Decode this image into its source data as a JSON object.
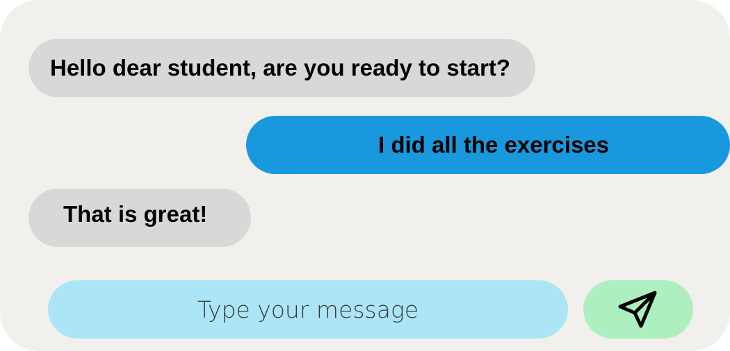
{
  "chat": {
    "messages": [
      {
        "sender": "teacher",
        "text": "Hello dear student, are you ready to start?"
      },
      {
        "sender": "student",
        "text": "I did all the exercises"
      },
      {
        "sender": "teacher",
        "text": "That is great!"
      }
    ]
  },
  "composer": {
    "placeholder": "Type your message",
    "send_icon": "send-paper-plane-icon"
  },
  "colors": {
    "panel_background": "#f2f0ec",
    "incoming_bubble": "#d8d8d8",
    "outgoing_bubble": "#1a98dd",
    "input_background": "#ace6f6",
    "send_button": "#aeefc0"
  }
}
